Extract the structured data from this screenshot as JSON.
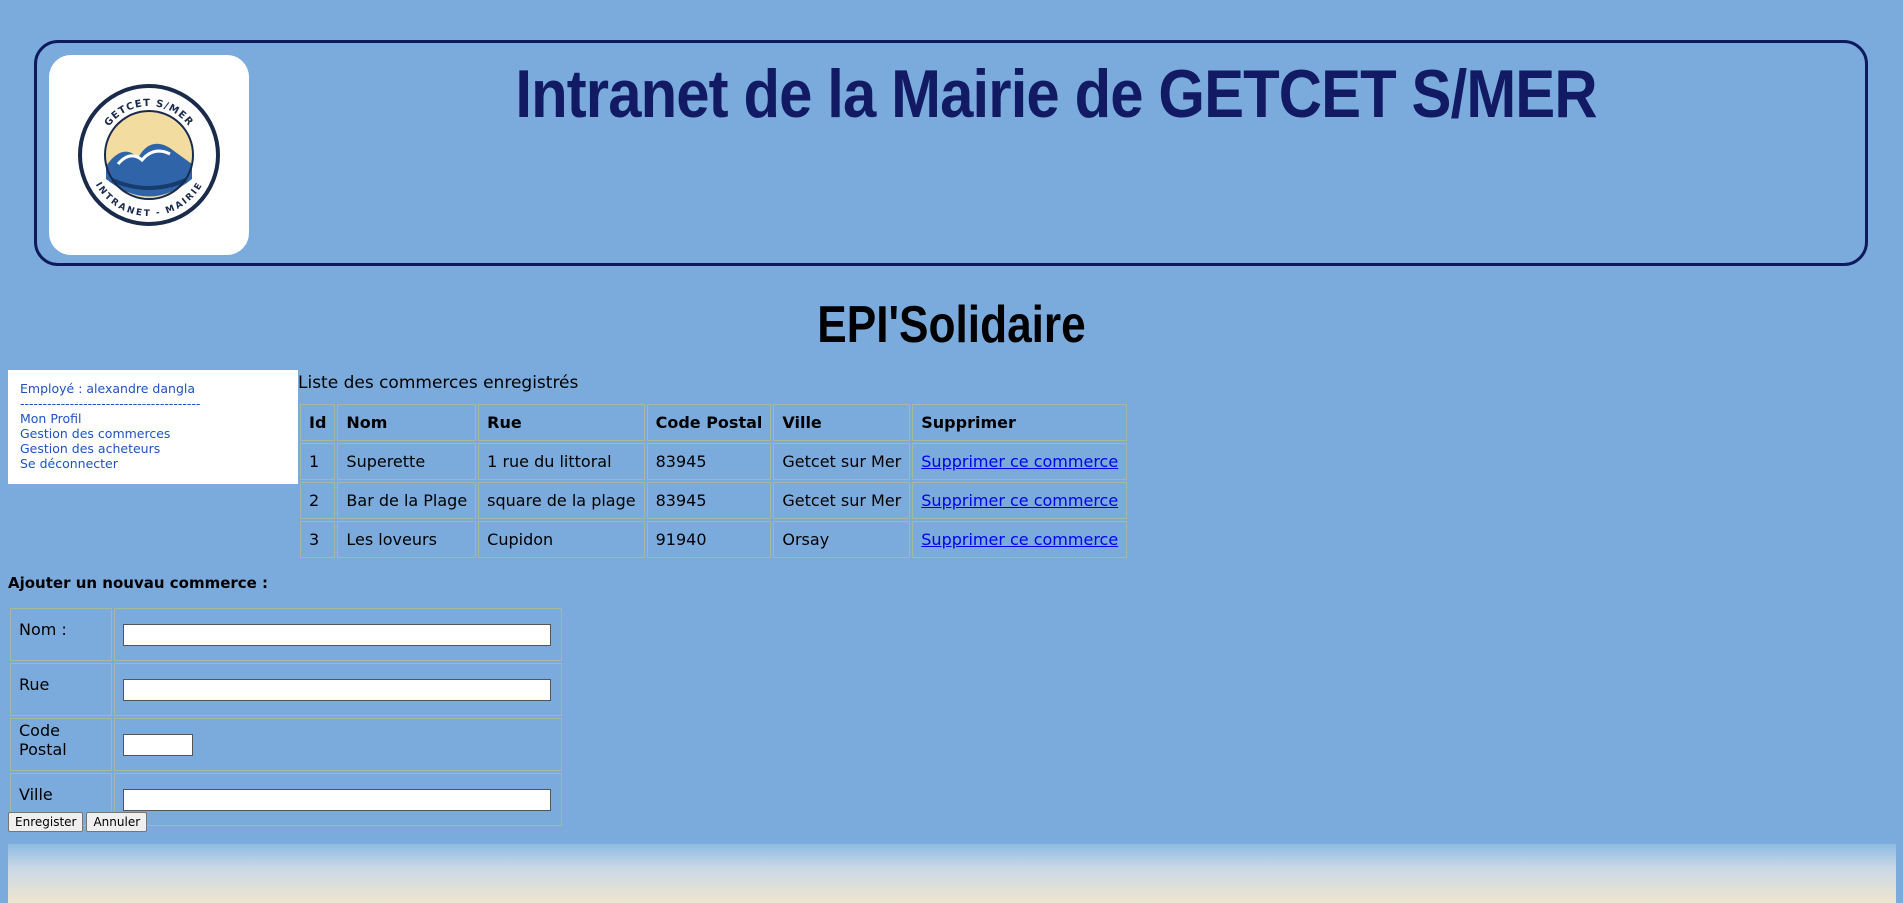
{
  "header": {
    "title": "Intranet de la Mairie de GETCET S/MER",
    "logo": {
      "top_text": "GETCET S/MER",
      "bottom_text": "INTRANET - MAIRIE",
      "icon": "wave-logo-icon"
    }
  },
  "section_title": "EPI'Solidaire",
  "sidebar": {
    "employee": "Employé : alexandre dangla",
    "separator": "----------------------------------------",
    "links": [
      "Mon Profil",
      "Gestion des commerces",
      "Gestion des acheteurs",
      "Se déconnecter"
    ]
  },
  "list": {
    "caption": "Liste des commerces enregistrés",
    "columns": [
      "Id",
      "Nom",
      "Rue",
      "Code Postal",
      "Ville",
      "Supprimer"
    ],
    "rows": [
      {
        "id": "1",
        "nom": "Superette",
        "rue": "1 rue du littoral",
        "cp": "83945",
        "ville": "Getcet sur Mer",
        "action": "Supprimer ce commerce"
      },
      {
        "id": "2",
        "nom": "Bar de la Plage",
        "rue": "square de la plage",
        "cp": "83945",
        "ville": "Getcet sur Mer",
        "action": "Supprimer ce commerce"
      },
      {
        "id": "3",
        "nom": "Les loveurs",
        "rue": "Cupidon",
        "cp": "91940",
        "ville": "Orsay",
        "action": "Supprimer ce commerce"
      }
    ]
  },
  "form": {
    "heading": "Ajouter un nouvau commerce :",
    "fields": [
      {
        "label": "Nom :",
        "value": ""
      },
      {
        "label": "Rue",
        "value": ""
      },
      {
        "label": "Code Postal",
        "value": ""
      },
      {
        "label": "Ville",
        "value": ""
      }
    ],
    "save_label": "Enregister",
    "cancel_label": "Annuler"
  },
  "colors": {
    "background": "#7aabdc",
    "title": "#111a63",
    "link": "#0000ee",
    "sidebar_link": "#1d52c7"
  }
}
